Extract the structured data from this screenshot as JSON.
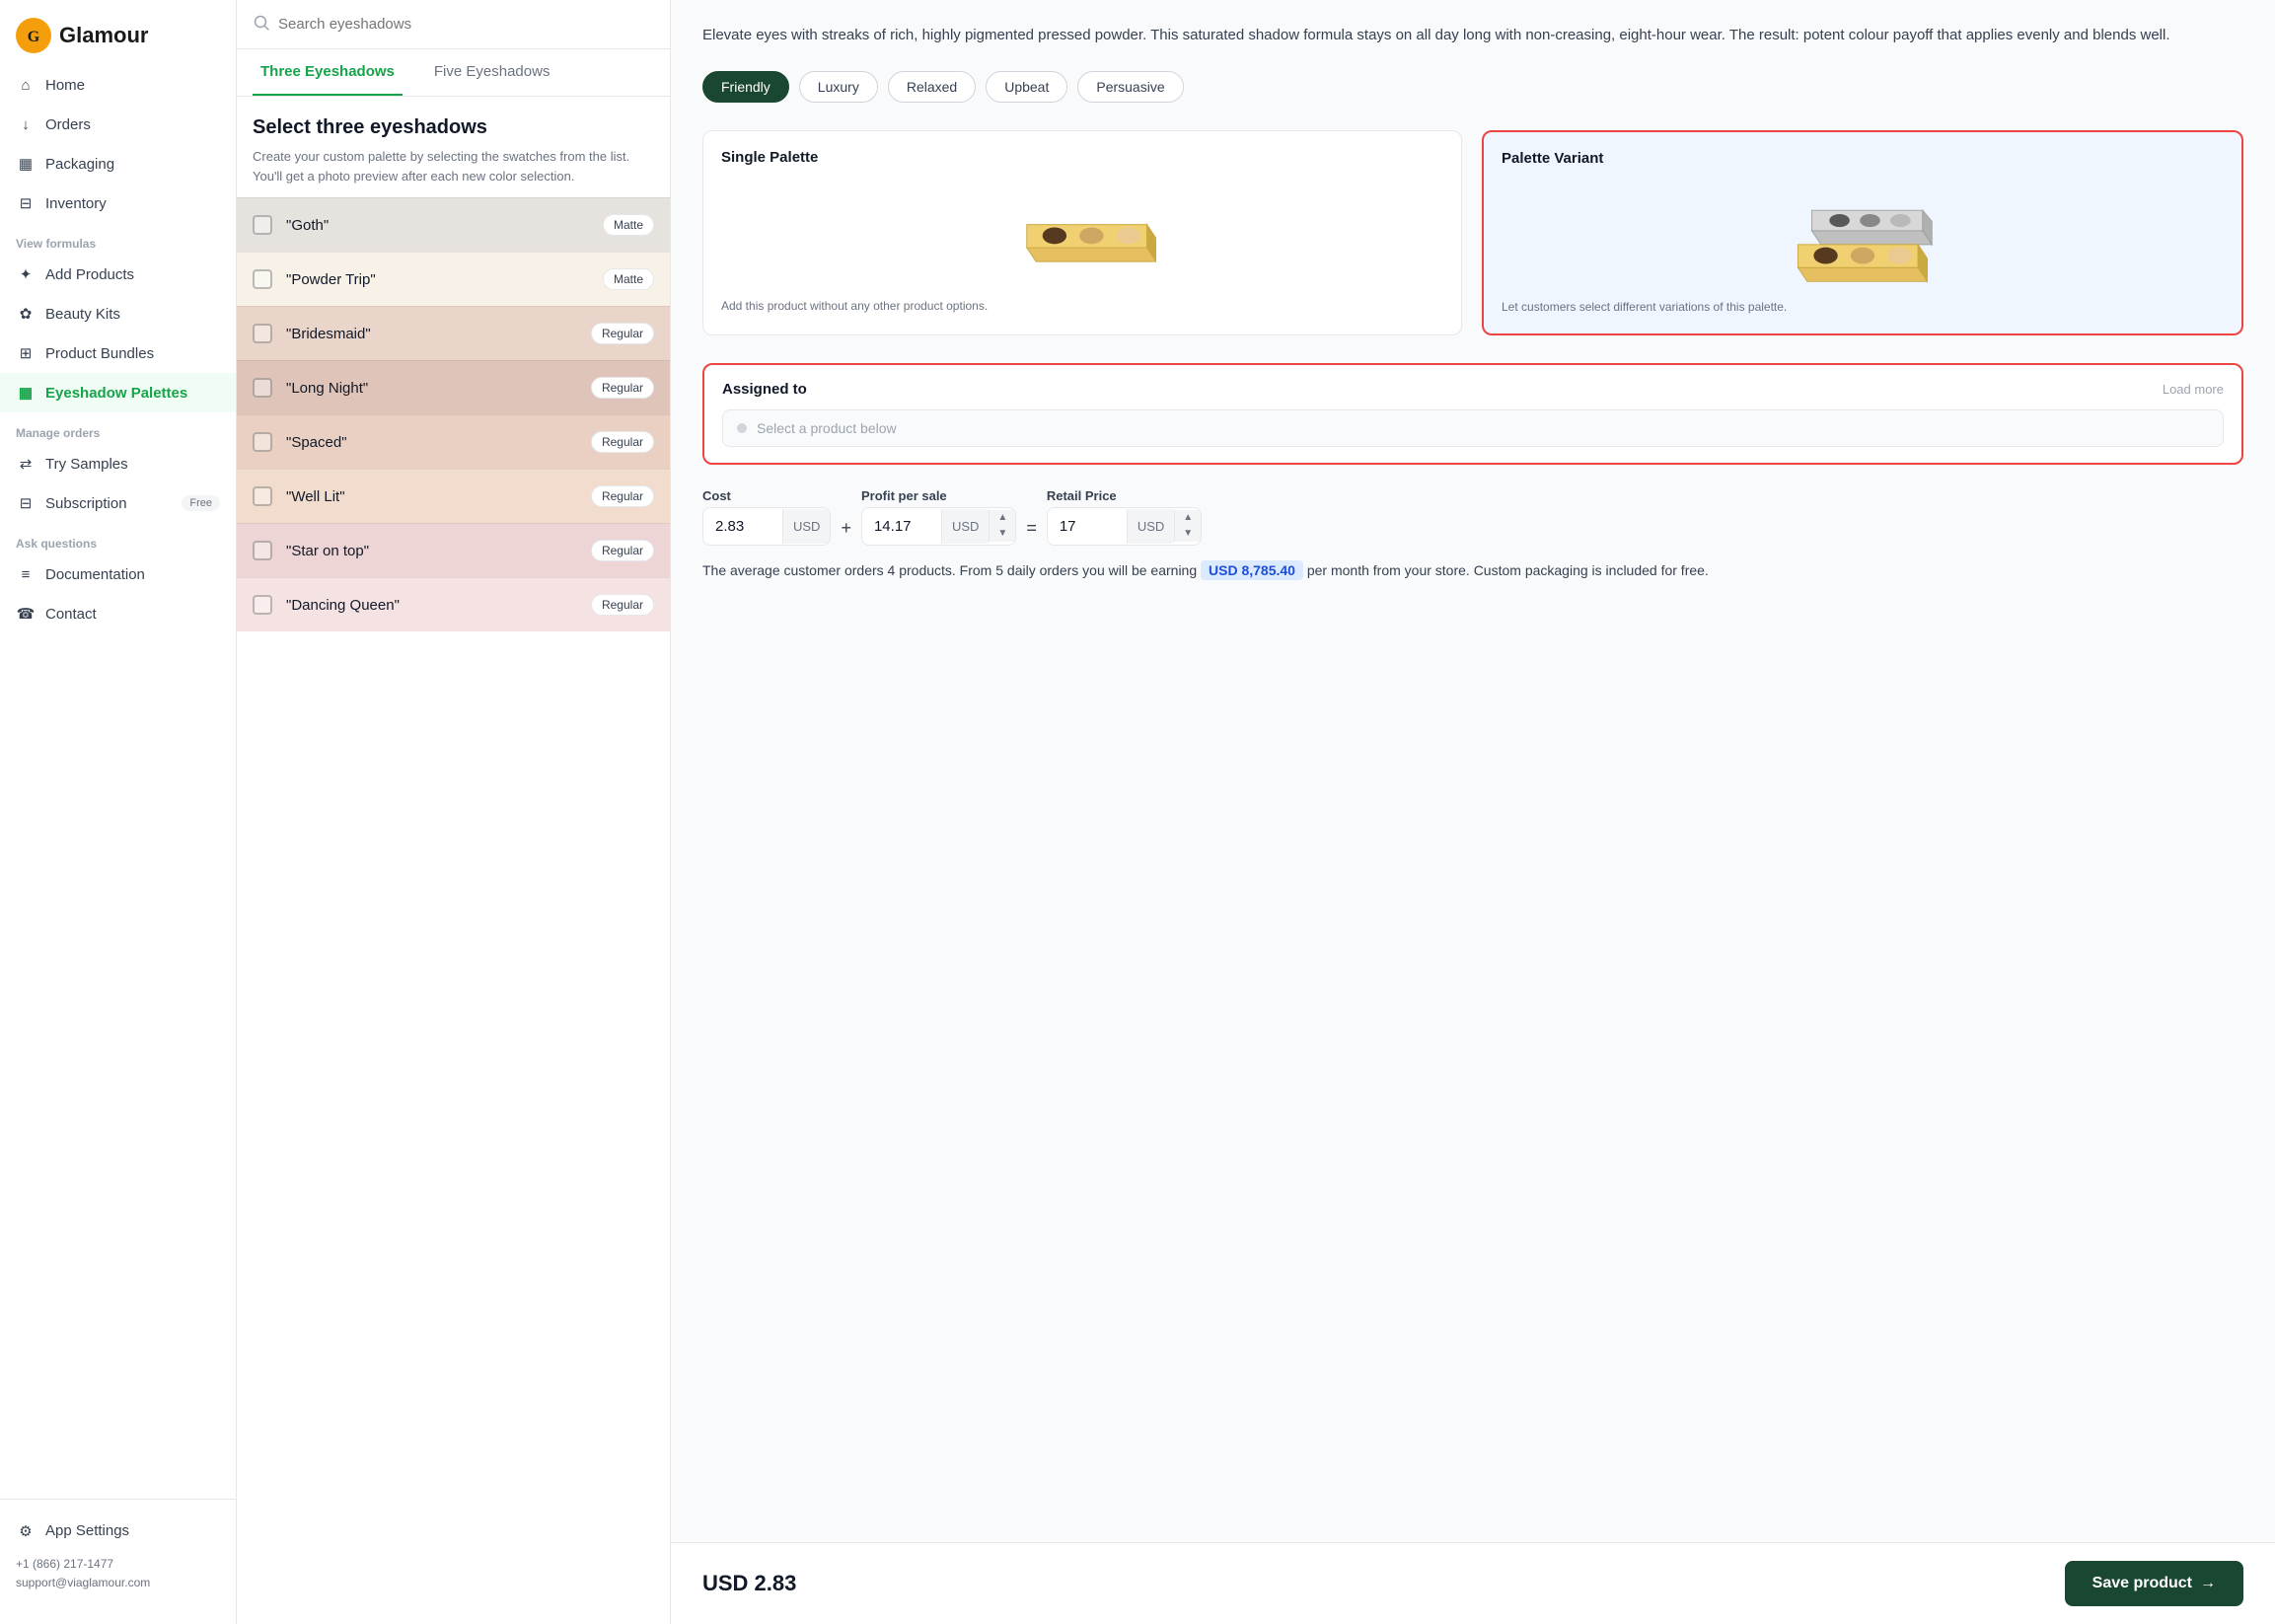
{
  "logo": {
    "text": "Glamour"
  },
  "sidebar": {
    "main_nav": [
      {
        "id": "home",
        "label": "Home",
        "icon": "home"
      },
      {
        "id": "orders",
        "label": "Orders",
        "icon": "orders"
      },
      {
        "id": "packaging",
        "label": "Packaging",
        "icon": "packaging"
      },
      {
        "id": "inventory",
        "label": "Inventory",
        "icon": "inventory"
      }
    ],
    "view_formulas_label": "View formulas",
    "formulas_nav": [
      {
        "id": "add-products",
        "label": "Add Products",
        "icon": "add-products"
      },
      {
        "id": "beauty-kits",
        "label": "Beauty Kits",
        "icon": "beauty-kits"
      },
      {
        "id": "product-bundles",
        "label": "Product Bundles",
        "icon": "product-bundles"
      },
      {
        "id": "eyeshadow-palettes",
        "label": "Eyeshadow Palettes",
        "icon": "eyeshadow",
        "active": true
      }
    ],
    "manage_orders_label": "Manage orders",
    "manage_nav": [
      {
        "id": "try-samples",
        "label": "Try Samples",
        "icon": "try"
      },
      {
        "id": "subscription",
        "label": "Subscription",
        "icon": "subscription",
        "badge": "Free"
      }
    ],
    "ask_questions_label": "Ask questions",
    "ask_nav": [
      {
        "id": "documentation",
        "label": "Documentation",
        "icon": "docs"
      },
      {
        "id": "contact",
        "label": "Contact",
        "icon": "contact"
      }
    ],
    "app_settings": "App Settings",
    "phone": "+1 (866) 217-1477",
    "email": "support@viaglamour.com"
  },
  "middle": {
    "search_placeholder": "Search eyeshadows",
    "tabs": [
      {
        "id": "three",
        "label": "Three Eyeshadows",
        "active": true
      },
      {
        "id": "five",
        "label": "Five Eyeshadows",
        "active": false
      }
    ],
    "heading": "Select three eyeshadows",
    "subheading": "Create your custom palette by selecting the swatches from the list. You'll get a photo preview after each new color selection.",
    "items": [
      {
        "name": "\"Goth\"",
        "type": "Matte",
        "color": "#b5a99a"
      },
      {
        "name": "\"Powder Trip\"",
        "type": "Matte",
        "color": "#e8d5b8"
      },
      {
        "name": "\"Bridesmaid\"",
        "type": "Regular",
        "color": "#c08060"
      },
      {
        "name": "\"Long Night\"",
        "type": "Regular",
        "color": "#a0522d"
      },
      {
        "name": "\"Spaced\"",
        "type": "Regular",
        "color": "#c0734a"
      },
      {
        "name": "\"Well Lit\"",
        "type": "Regular",
        "color": "#d4956a"
      },
      {
        "name": "\"Star on top\"",
        "type": "Regular",
        "color": "#cd8080"
      },
      {
        "name": "\"Dancing Queen\"",
        "type": "Regular",
        "color": "#e0a8a8"
      }
    ]
  },
  "right": {
    "description": "Elevate eyes with streaks of rich, highly pigmented pressed powder. This saturated shadow formula stays on all day long with non-creasing, eight-hour wear. The result: potent colour payoff that applies evenly and blends well.",
    "tones": [
      {
        "id": "friendly",
        "label": "Friendly",
        "active": true
      },
      {
        "id": "luxury",
        "label": "Luxury",
        "active": false
      },
      {
        "id": "relaxed",
        "label": "Relaxed",
        "active": false
      },
      {
        "id": "upbeat",
        "label": "Upbeat",
        "active": false
      },
      {
        "id": "persuasive",
        "label": "Persuasive",
        "active": false
      }
    ],
    "palette_cards": [
      {
        "id": "single",
        "title": "Single Palette",
        "desc": "Add this product without any other product options.",
        "selected": false
      },
      {
        "id": "variant",
        "title": "Palette Variant",
        "desc": "Let customers select different variations of this palette.",
        "selected": true
      }
    ],
    "assigned": {
      "title": "Assigned to",
      "load_more": "Load more",
      "placeholder": "Select a product below"
    },
    "pricing": {
      "cost_label": "Cost",
      "profit_label": "Profit per sale",
      "retail_label": "Retail Price",
      "cost_value": "2.83",
      "profit_value": "14.17",
      "retail_value": "17",
      "currency": "USD",
      "plus": "+",
      "equals": "="
    },
    "earnings_text_1": "The average customer orders 4 products. From 5 daily orders you will be earning",
    "earnings_highlight": "USD 8,785.40",
    "earnings_text_2": "per month from your store. Custom packaging is included for free.",
    "footer": {
      "price": "USD 2.83",
      "save_label": "Save product",
      "arrow": "→"
    }
  }
}
